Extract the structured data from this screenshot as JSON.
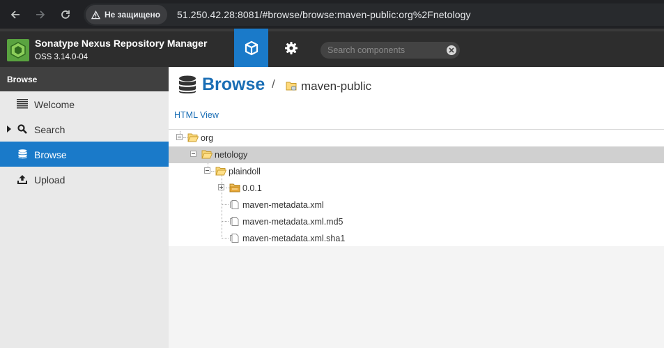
{
  "browser": {
    "security_label": "Не защищено",
    "url": "51.250.42.28:8081/#browse/browse:maven-public:org%2Fnetology"
  },
  "app": {
    "title": "Sonatype Nexus Repository Manager",
    "version": "OSS 3.14.0-04",
    "search_placeholder": "Search components",
    "accent_color": "#1a7ac9"
  },
  "sidebar": {
    "header": "Browse",
    "items": [
      {
        "label": "Welcome",
        "icon": "list-icon"
      },
      {
        "label": "Search",
        "icon": "magnifier-icon"
      },
      {
        "label": "Browse",
        "icon": "database-icon"
      },
      {
        "label": "Upload",
        "icon": "upload-icon"
      }
    ],
    "active_index": 2
  },
  "main": {
    "title": "Browse",
    "breadcrumb_separator": "/",
    "repository": "maven-public",
    "html_view_label": "HTML View",
    "tree": [
      {
        "label": "org",
        "icon": "folder-open-icon",
        "level": 0
      },
      {
        "label": "netology",
        "icon": "folder-open-icon",
        "level": 1,
        "selected": true
      },
      {
        "label": "plaindoll",
        "icon": "folder-open-icon",
        "level": 2
      },
      {
        "label": "0.0.1",
        "icon": "component-folder-icon",
        "level": 3
      },
      {
        "label": "maven-metadata.xml",
        "icon": "file-icon",
        "level": 3
      },
      {
        "label": "maven-metadata.xml.md5",
        "icon": "file-icon",
        "level": 3
      },
      {
        "label": "maven-metadata.xml.sha1",
        "icon": "file-icon",
        "level": 3
      }
    ]
  }
}
